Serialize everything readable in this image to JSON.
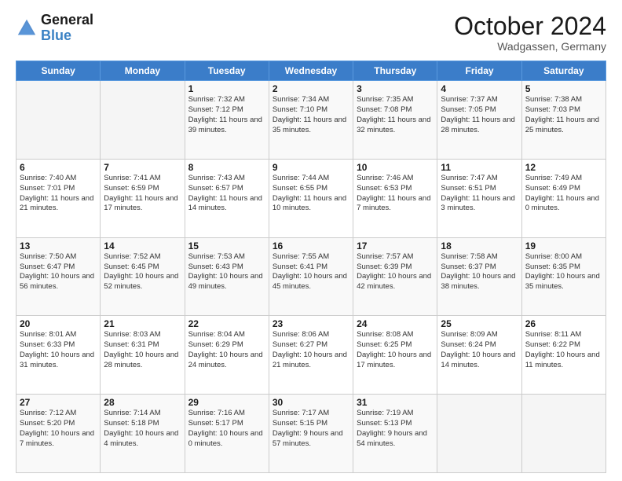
{
  "logo": {
    "text_general": "General",
    "text_blue": "Blue"
  },
  "header": {
    "month": "October 2024",
    "location": "Wadgassen, Germany"
  },
  "weekdays": [
    "Sunday",
    "Monday",
    "Tuesday",
    "Wednesday",
    "Thursday",
    "Friday",
    "Saturday"
  ],
  "weeks": [
    [
      {
        "day": "",
        "sunrise": "",
        "sunset": "",
        "daylight": ""
      },
      {
        "day": "",
        "sunrise": "",
        "sunset": "",
        "daylight": ""
      },
      {
        "day": "1",
        "sunrise": "Sunrise: 7:32 AM",
        "sunset": "Sunset: 7:12 PM",
        "daylight": "Daylight: 11 hours and 39 minutes."
      },
      {
        "day": "2",
        "sunrise": "Sunrise: 7:34 AM",
        "sunset": "Sunset: 7:10 PM",
        "daylight": "Daylight: 11 hours and 35 minutes."
      },
      {
        "day": "3",
        "sunrise": "Sunrise: 7:35 AM",
        "sunset": "Sunset: 7:08 PM",
        "daylight": "Daylight: 11 hours and 32 minutes."
      },
      {
        "day": "4",
        "sunrise": "Sunrise: 7:37 AM",
        "sunset": "Sunset: 7:05 PM",
        "daylight": "Daylight: 11 hours and 28 minutes."
      },
      {
        "day": "5",
        "sunrise": "Sunrise: 7:38 AM",
        "sunset": "Sunset: 7:03 PM",
        "daylight": "Daylight: 11 hours and 25 minutes."
      }
    ],
    [
      {
        "day": "6",
        "sunrise": "Sunrise: 7:40 AM",
        "sunset": "Sunset: 7:01 PM",
        "daylight": "Daylight: 11 hours and 21 minutes."
      },
      {
        "day": "7",
        "sunrise": "Sunrise: 7:41 AM",
        "sunset": "Sunset: 6:59 PM",
        "daylight": "Daylight: 11 hours and 17 minutes."
      },
      {
        "day": "8",
        "sunrise": "Sunrise: 7:43 AM",
        "sunset": "Sunset: 6:57 PM",
        "daylight": "Daylight: 11 hours and 14 minutes."
      },
      {
        "day": "9",
        "sunrise": "Sunrise: 7:44 AM",
        "sunset": "Sunset: 6:55 PM",
        "daylight": "Daylight: 11 hours and 10 minutes."
      },
      {
        "day": "10",
        "sunrise": "Sunrise: 7:46 AM",
        "sunset": "Sunset: 6:53 PM",
        "daylight": "Daylight: 11 hours and 7 minutes."
      },
      {
        "day": "11",
        "sunrise": "Sunrise: 7:47 AM",
        "sunset": "Sunset: 6:51 PM",
        "daylight": "Daylight: 11 hours and 3 minutes."
      },
      {
        "day": "12",
        "sunrise": "Sunrise: 7:49 AM",
        "sunset": "Sunset: 6:49 PM",
        "daylight": "Daylight: 11 hours and 0 minutes."
      }
    ],
    [
      {
        "day": "13",
        "sunrise": "Sunrise: 7:50 AM",
        "sunset": "Sunset: 6:47 PM",
        "daylight": "Daylight: 10 hours and 56 minutes."
      },
      {
        "day": "14",
        "sunrise": "Sunrise: 7:52 AM",
        "sunset": "Sunset: 6:45 PM",
        "daylight": "Daylight: 10 hours and 52 minutes."
      },
      {
        "day": "15",
        "sunrise": "Sunrise: 7:53 AM",
        "sunset": "Sunset: 6:43 PM",
        "daylight": "Daylight: 10 hours and 49 minutes."
      },
      {
        "day": "16",
        "sunrise": "Sunrise: 7:55 AM",
        "sunset": "Sunset: 6:41 PM",
        "daylight": "Daylight: 10 hours and 45 minutes."
      },
      {
        "day": "17",
        "sunrise": "Sunrise: 7:57 AM",
        "sunset": "Sunset: 6:39 PM",
        "daylight": "Daylight: 10 hours and 42 minutes."
      },
      {
        "day": "18",
        "sunrise": "Sunrise: 7:58 AM",
        "sunset": "Sunset: 6:37 PM",
        "daylight": "Daylight: 10 hours and 38 minutes."
      },
      {
        "day": "19",
        "sunrise": "Sunrise: 8:00 AM",
        "sunset": "Sunset: 6:35 PM",
        "daylight": "Daylight: 10 hours and 35 minutes."
      }
    ],
    [
      {
        "day": "20",
        "sunrise": "Sunrise: 8:01 AM",
        "sunset": "Sunset: 6:33 PM",
        "daylight": "Daylight: 10 hours and 31 minutes."
      },
      {
        "day": "21",
        "sunrise": "Sunrise: 8:03 AM",
        "sunset": "Sunset: 6:31 PM",
        "daylight": "Daylight: 10 hours and 28 minutes."
      },
      {
        "day": "22",
        "sunrise": "Sunrise: 8:04 AM",
        "sunset": "Sunset: 6:29 PM",
        "daylight": "Daylight: 10 hours and 24 minutes."
      },
      {
        "day": "23",
        "sunrise": "Sunrise: 8:06 AM",
        "sunset": "Sunset: 6:27 PM",
        "daylight": "Daylight: 10 hours and 21 minutes."
      },
      {
        "day": "24",
        "sunrise": "Sunrise: 8:08 AM",
        "sunset": "Sunset: 6:25 PM",
        "daylight": "Daylight: 10 hours and 17 minutes."
      },
      {
        "day": "25",
        "sunrise": "Sunrise: 8:09 AM",
        "sunset": "Sunset: 6:24 PM",
        "daylight": "Daylight: 10 hours and 14 minutes."
      },
      {
        "day": "26",
        "sunrise": "Sunrise: 8:11 AM",
        "sunset": "Sunset: 6:22 PM",
        "daylight": "Daylight: 10 hours and 11 minutes."
      }
    ],
    [
      {
        "day": "27",
        "sunrise": "Sunrise: 7:12 AM",
        "sunset": "Sunset: 5:20 PM",
        "daylight": "Daylight: 10 hours and 7 minutes."
      },
      {
        "day": "28",
        "sunrise": "Sunrise: 7:14 AM",
        "sunset": "Sunset: 5:18 PM",
        "daylight": "Daylight: 10 hours and 4 minutes."
      },
      {
        "day": "29",
        "sunrise": "Sunrise: 7:16 AM",
        "sunset": "Sunset: 5:17 PM",
        "daylight": "Daylight: 10 hours and 0 minutes."
      },
      {
        "day": "30",
        "sunrise": "Sunrise: 7:17 AM",
        "sunset": "Sunset: 5:15 PM",
        "daylight": "Daylight: 9 hours and 57 minutes."
      },
      {
        "day": "31",
        "sunrise": "Sunrise: 7:19 AM",
        "sunset": "Sunset: 5:13 PM",
        "daylight": "Daylight: 9 hours and 54 minutes."
      },
      {
        "day": "",
        "sunrise": "",
        "sunset": "",
        "daylight": ""
      },
      {
        "day": "",
        "sunrise": "",
        "sunset": "",
        "daylight": ""
      }
    ]
  ]
}
